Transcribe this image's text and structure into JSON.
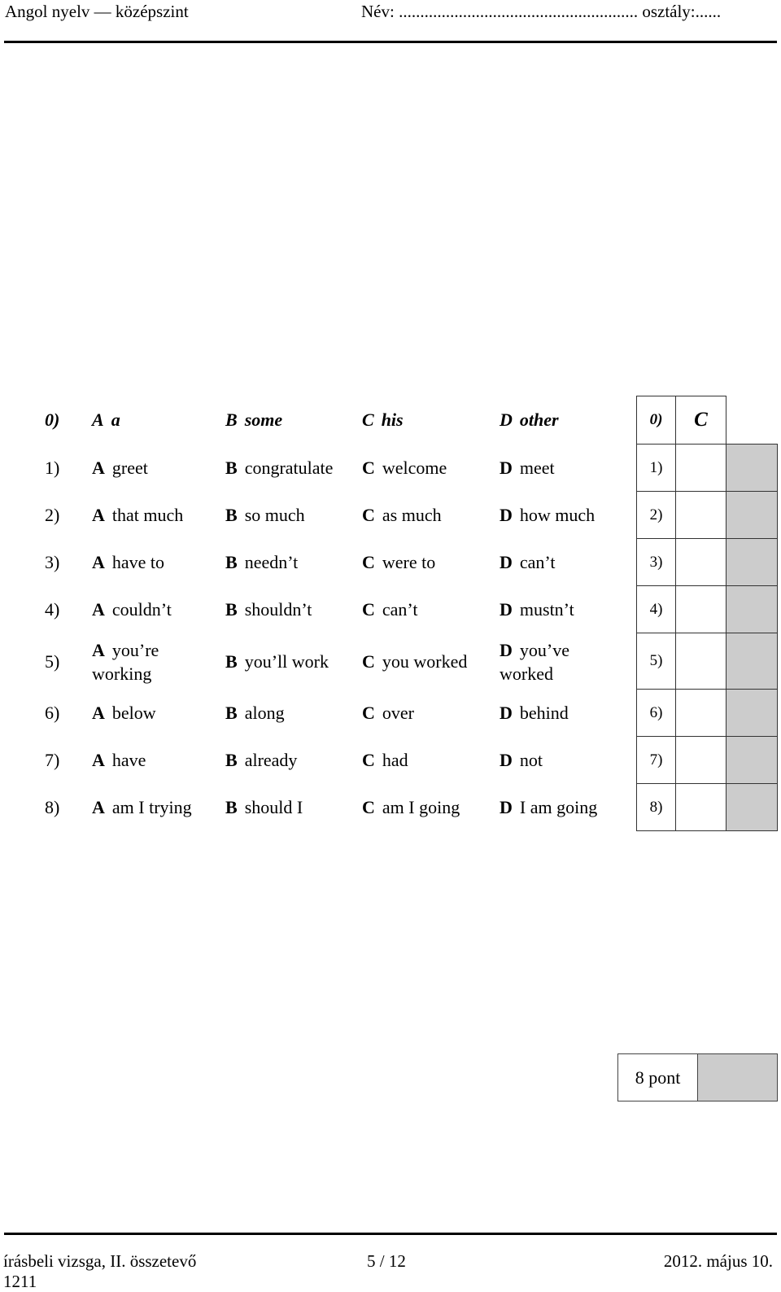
{
  "header": {
    "subject": "Angol nyelv — középszint",
    "name_field": "Név: ........................................................ osztály:......"
  },
  "questions": [
    {
      "num": "0)",
      "A": "a",
      "B": "some",
      "C": "his",
      "D": "other",
      "example": true
    },
    {
      "num": "1)",
      "A": "greet",
      "B": "congratulate",
      "C": "welcome",
      "D": "meet"
    },
    {
      "num": "2)",
      "A": "that much",
      "B": "so much",
      "C": "as much",
      "D": "how much"
    },
    {
      "num": "3)",
      "A": "have to",
      "B": "needn’t",
      "C": "were to",
      "D": "can’t"
    },
    {
      "num": "4)",
      "A": "couldn’t",
      "B": "shouldn’t",
      "C": "can’t",
      "D": "mustn’t"
    },
    {
      "num": "5)",
      "A": "you’re working",
      "B": "you’ll work",
      "C": "you worked",
      "D": "you’ve worked"
    },
    {
      "num": "6)",
      "A": "below",
      "B": "along",
      "C": "over",
      "D": "behind"
    },
    {
      "num": "7)",
      "A": "have",
      "B": "already",
      "C": "had",
      "D": "not"
    },
    {
      "num": "8)",
      "A": "am I trying",
      "B": "should I",
      "C": "am I going",
      "D": "I am going"
    }
  ],
  "letters": {
    "A": "A",
    "B": "B",
    "C": "C",
    "D": "D"
  },
  "answer_grid": [
    {
      "num": "0)",
      "answer": "C"
    },
    {
      "num": "1)",
      "answer": ""
    },
    {
      "num": "2)",
      "answer": ""
    },
    {
      "num": "3)",
      "answer": ""
    },
    {
      "num": "4)",
      "answer": ""
    },
    {
      "num": "5)",
      "answer": ""
    },
    {
      "num": "6)",
      "answer": ""
    },
    {
      "num": "7)",
      "answer": ""
    },
    {
      "num": "8)",
      "answer": ""
    }
  ],
  "points": {
    "label": "8 pont"
  },
  "footer": {
    "left_line1": "írásbeli vizsga, II. összetevő",
    "left_line2": "1211",
    "page": "5 / 12",
    "date": "2012. május 10."
  }
}
